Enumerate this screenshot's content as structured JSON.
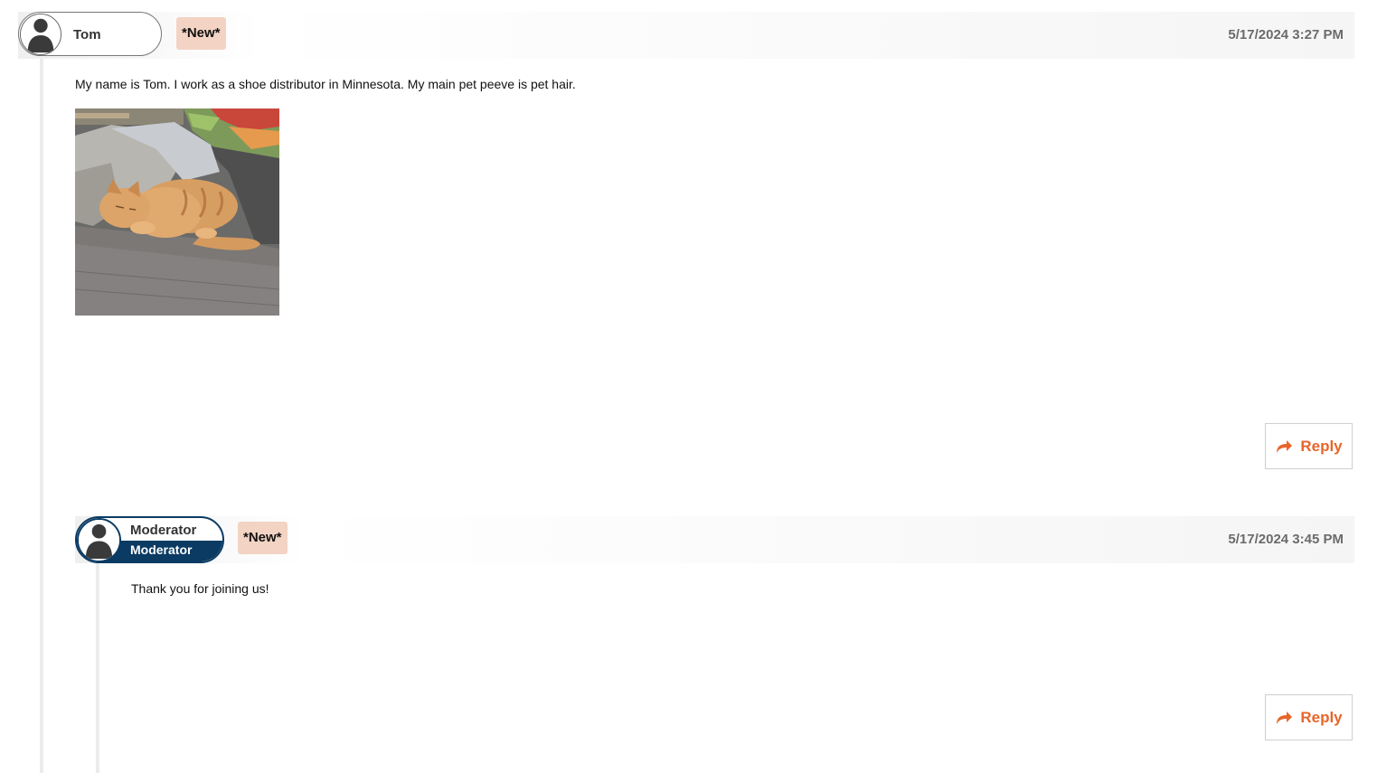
{
  "posts": [
    {
      "author": "Tom",
      "badge": "*New*",
      "timestamp": "5/17/2024 3:27 PM",
      "body": "My name is Tom. I work as a shoe distributor in Minnesota. My main pet peeve is pet hair.",
      "has_image": true,
      "reply_label": "Reply"
    },
    {
      "author": "Moderator",
      "role": "Moderator",
      "badge": "*New*",
      "timestamp": "5/17/2024 3:45 PM",
      "body": "Thank you for joining us!",
      "reply_label": "Reply"
    }
  ],
  "colors": {
    "accent": "#e8652b",
    "moderator_band": "#0b3b63",
    "badge_bg": "#f3d3c3",
    "timestamp": "#6b6b6b"
  },
  "icons": {
    "avatar": "user-silhouette-icon",
    "reply": "reply-arrow-icon"
  }
}
